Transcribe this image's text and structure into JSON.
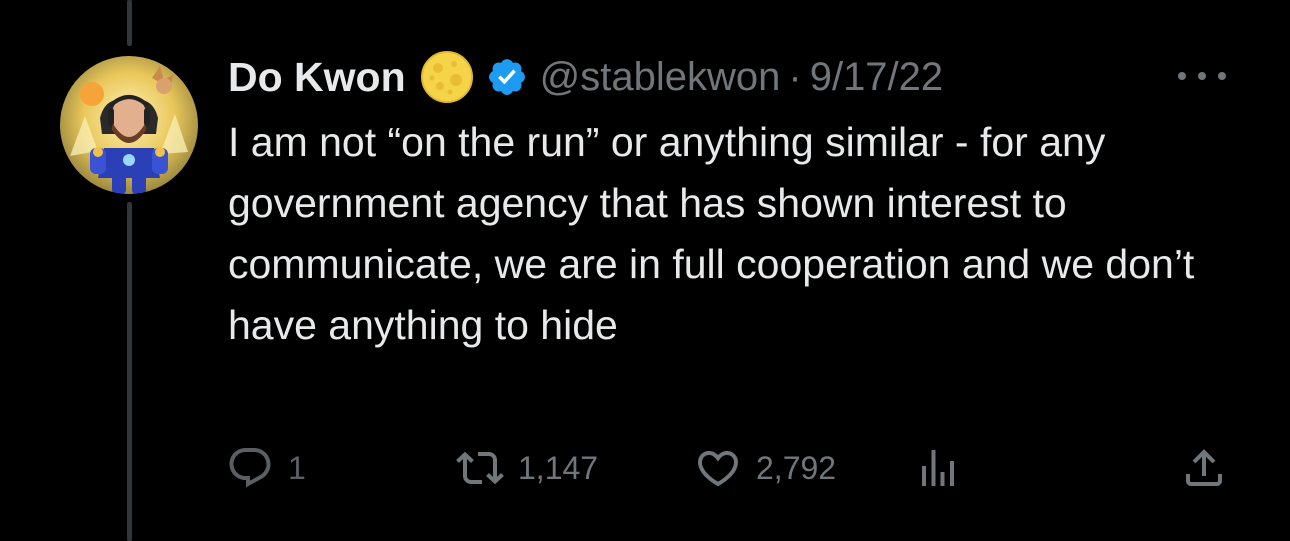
{
  "tweet": {
    "author": {
      "display_name": "Do Kwon",
      "name_emoji": "full-moon-emoji",
      "verified": true,
      "handle": "@stablekwon"
    },
    "separator": "·",
    "date": "9/17/22",
    "text": "I am not “on the run” or anything similar - for any government agency that has shown interest to communicate, we are in full cooperation and we don’t have anything to hide",
    "stats": {
      "replies": "1",
      "retweets": "1,147",
      "likes": "2,792"
    }
  },
  "icons": {
    "more": "more-horizontal-icon",
    "reply": "reply-bubble-icon",
    "retweet": "retweet-icon",
    "like": "heart-icon",
    "views": "analytics-bars-icon",
    "share": "share-upload-icon",
    "verified": "verified-badge-icon"
  },
  "colors": {
    "background": "#000000",
    "text_primary": "#e7e9ea",
    "text_secondary": "#71767b",
    "verified_blue": "#1d9bf0",
    "moon_yellow": "#f6d44a"
  }
}
